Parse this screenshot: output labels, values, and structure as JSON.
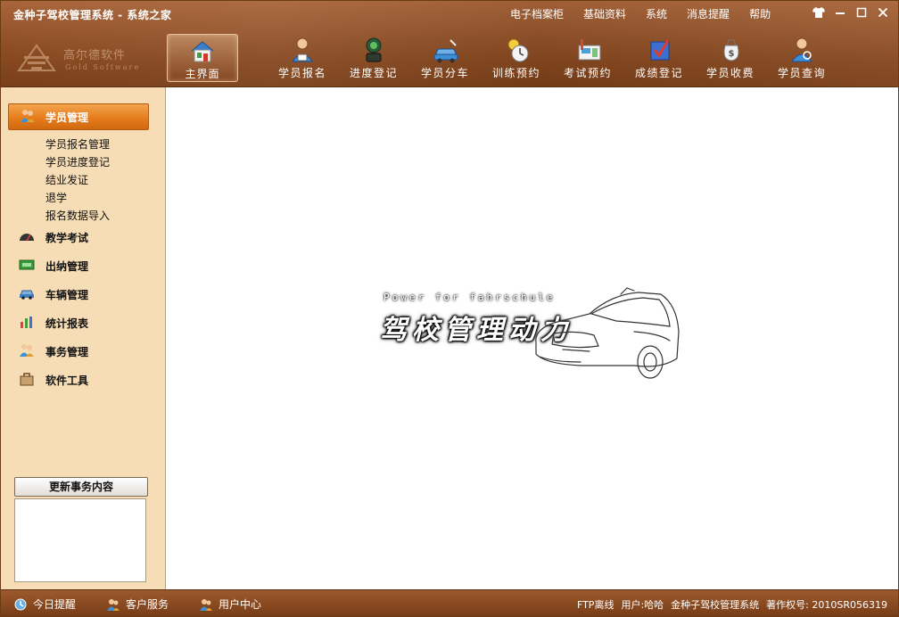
{
  "window": {
    "title": "金种子驾校管理系统 - 系统之家"
  },
  "top_menu": [
    "电子档案柜",
    "基础资料",
    "系统",
    "消息提醒",
    "帮助"
  ],
  "logo": {
    "name": "高尔德软件",
    "sub": "Gold Software"
  },
  "toolbar": {
    "home": "主界面",
    "items": [
      {
        "label": "学员报名",
        "icon": "student-registration-icon"
      },
      {
        "label": "进度登记",
        "icon": "progress-register-icon"
      },
      {
        "label": "学员分车",
        "icon": "vehicle-assign-icon"
      },
      {
        "label": "训练预约",
        "icon": "training-booking-icon"
      },
      {
        "label": "考试预约",
        "icon": "exam-booking-icon"
      },
      {
        "label": "成绩登记",
        "icon": "score-register-icon"
      },
      {
        "label": "学员收费",
        "icon": "fee-collection-icon"
      },
      {
        "label": "学员查询",
        "icon": "student-search-icon"
      }
    ]
  },
  "sidebar": {
    "active": "学员管理",
    "sub_items": [
      "学员报名管理",
      "学员进度登记",
      "结业发证",
      "退学",
      "报名数据导入"
    ],
    "items": [
      {
        "label": "教学考试",
        "icon": "speedometer-icon"
      },
      {
        "label": "出纳管理",
        "icon": "cash-icon"
      },
      {
        "label": "车辆管理",
        "icon": "car-icon"
      },
      {
        "label": "统计报表",
        "icon": "bar-chart-icon"
      },
      {
        "label": "事务管理",
        "icon": "people-icon"
      },
      {
        "label": "软件工具",
        "icon": "toolbox-icon"
      }
    ],
    "update_button": "更新事务内容"
  },
  "main": {
    "brand_en": "Power for fahrschule",
    "brand_cn": "驾校管理动力"
  },
  "statusbar": {
    "links": [
      "今日提醒",
      "客户服务",
      "用户中心"
    ],
    "ftp": "FTP离线",
    "user_label": "用户:",
    "user": "哈哈",
    "product": "金种子驾校管理系统",
    "copyright": "著作权号: 2010SR056319"
  },
  "colors": {
    "header_brown": "#94542b",
    "sidebar_bg": "#f6ddb5",
    "active_orange": "#e67d1c"
  }
}
